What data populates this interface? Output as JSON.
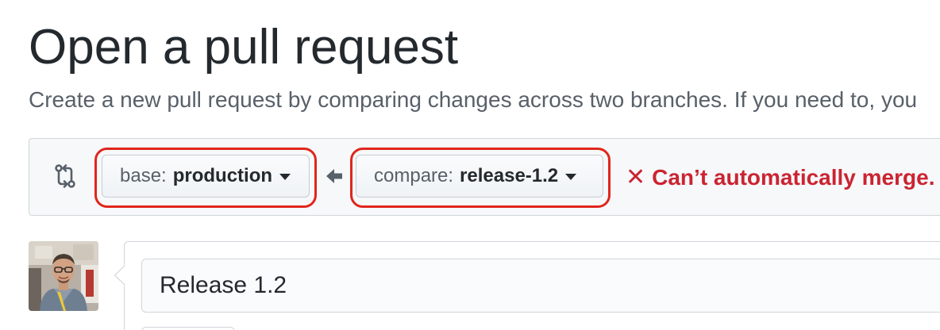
{
  "header": {
    "title": "Open a pull request",
    "subtitle": "Create a new pull request by comparing changes across two branches. If you need to, you"
  },
  "range": {
    "base": {
      "prefix": "base:",
      "branch": "production"
    },
    "compare": {
      "prefix": "compare:",
      "branch": "release-1.2"
    },
    "merge_status": "Can’t automatically merge.",
    "merge_status_icon": "✕",
    "status_color": "#cb2431",
    "highlight_color": "#e0261c"
  },
  "icons": {
    "compare": "git-compare-icon",
    "arrow": "arrow-left-icon",
    "caret": "triangle-down-icon",
    "status": "x-icon"
  },
  "form": {
    "title_value": "Release 1.2"
  }
}
